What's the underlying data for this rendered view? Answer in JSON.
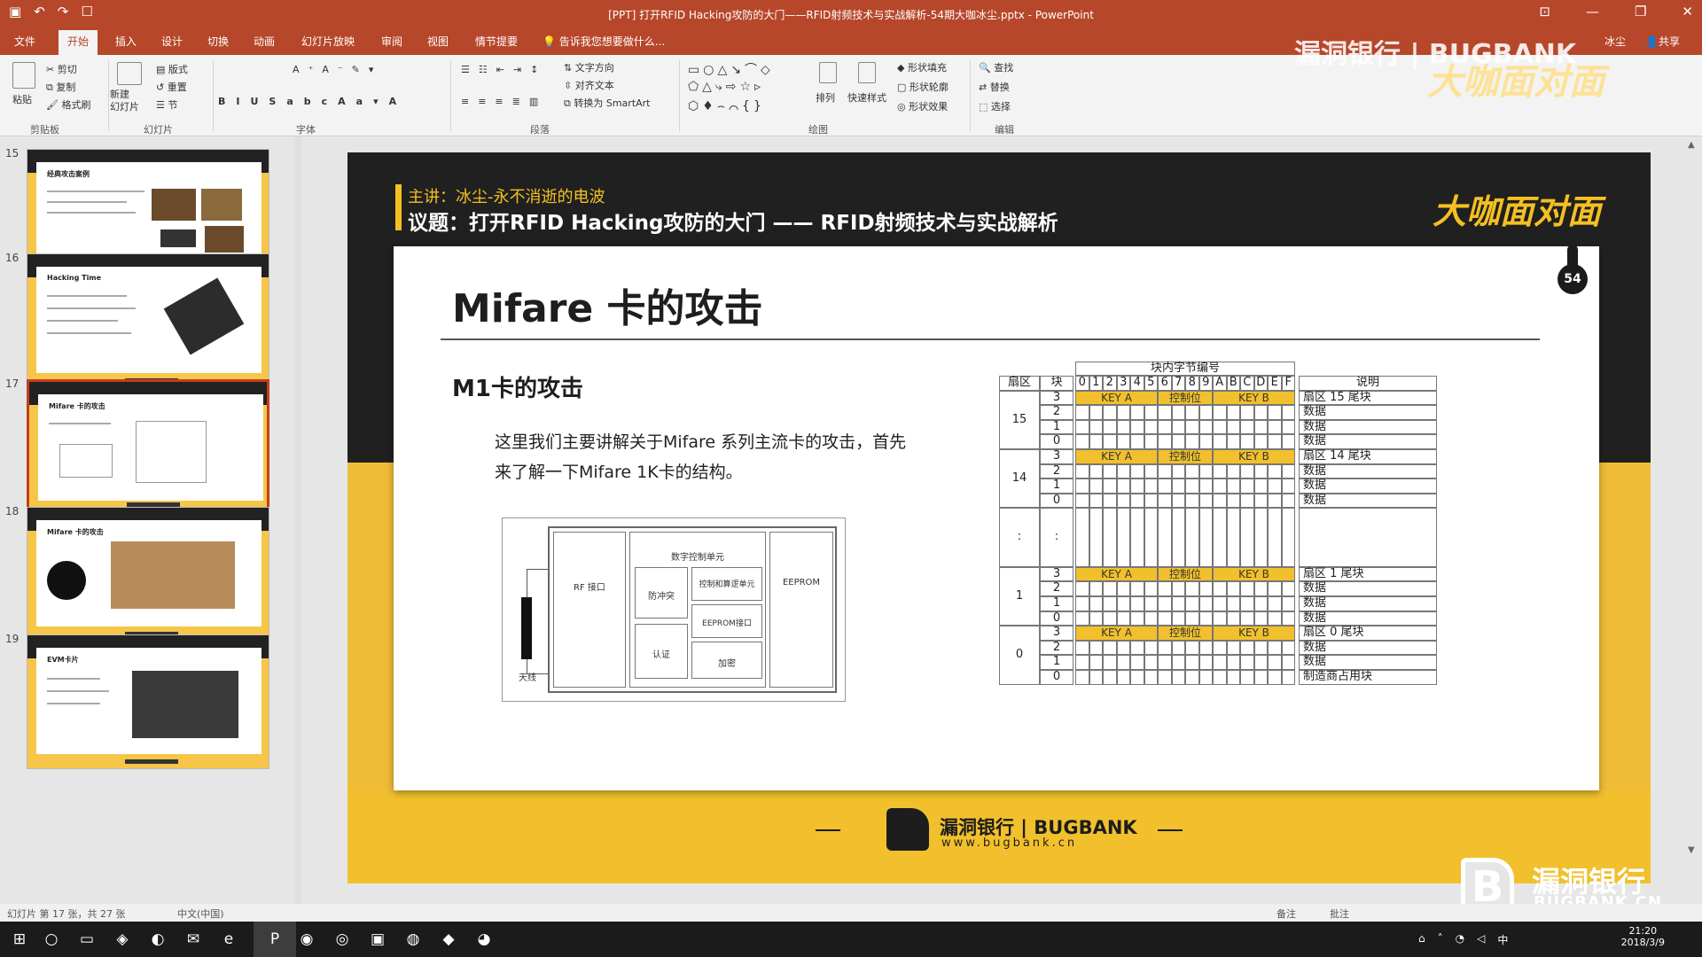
{
  "window": {
    "title": "[PPT] 打开RFID Hacking攻防的大门——RFID射频技术与实战解析-54期大咖冰尘.pptx - PowerPoint",
    "qat": [
      "▣",
      "↶",
      "↷",
      "☐"
    ]
  },
  "tabs": [
    "文件",
    "开始",
    "插入",
    "设计",
    "切换",
    "动画",
    "幻灯片放映",
    "审阅",
    "视图",
    "情节提要"
  ],
  "active_tab": "开始",
  "tell_me": "告诉我您想要做什么...",
  "account": {
    "user": "冰尘",
    "share": "共享"
  },
  "watermark_top": {
    "line1": "漏洞银行 | BUGBANK",
    "line2": "大咖面对面"
  },
  "ribbon": {
    "paste": "粘贴",
    "cut": "剪切",
    "copy": "复制",
    "format_painter": "格式刷",
    "new_slide": "新建\n幻灯片",
    "layout": "版式",
    "reset": "重置",
    "section": "节",
    "text_direction": "文字方向",
    "align_text": "对齐文本",
    "smartart": "转换为 SmartArt",
    "arrange": "排列",
    "quick_styles": "快速样式",
    "shape_fill": "形状填充",
    "shape_outline": "形状轮廓",
    "shape_effects": "形状效果",
    "find": "查找",
    "replace": "替换",
    "select": "选择",
    "groups": [
      "剪贴板",
      "幻灯片",
      "字体",
      "段落",
      "绘图",
      "编辑"
    ]
  },
  "thumbnails": [
    {
      "num": "15",
      "title": "经典攻击案例"
    },
    {
      "num": "16",
      "title": "Hacking Time"
    },
    {
      "num": "17",
      "title": "Mifare 卡的攻击"
    },
    {
      "num": "18",
      "title": "Mifare 卡的攻击"
    },
    {
      "num": "19",
      "title": "EVM卡片"
    }
  ],
  "slide": {
    "speaker": "主讲：冰尘-永不消逝的电波",
    "topic": "议题：打开RFID Hacking攻防的大门 —— RFID射频技术与实战解析",
    "brand": "大咖面对面",
    "page_num": "54",
    "title": "Mifare 卡的攻击",
    "subtitle": "M1卡的攻击",
    "para1": "这里我们主要讲解关于Mifare 系列主流卡的攻击，首先",
    "para2": "来了解一下Mifare 1K卡的结构。",
    "diagram": {
      "rf": "RF 接口",
      "digital": "数字控制单元",
      "anticoll": "防冲突",
      "control": "控制和算逻单元",
      "eeprom_if": "EEPROM接口",
      "auth": "认证",
      "crypto": "加密",
      "eeprom": "EEPROM",
      "antenna": "天线"
    },
    "table": {
      "header_bytes": "块内字节编号",
      "col_sector": "扇区",
      "col_block": "块",
      "col_desc": "说明",
      "byte_labels": [
        "0",
        "1",
        "2",
        "3",
        "4",
        "5",
        "6",
        "7",
        "8",
        "9",
        "A",
        "B",
        "C",
        "D",
        "E",
        "F"
      ],
      "key_a": "KEY A",
      "control_bits": "控制位",
      "key_b": "KEY B",
      "sectors": [
        {
          "sector": "15",
          "blocks": [
            "3",
            "2",
            "1",
            "0"
          ],
          "desc": [
            "扇区 15 尾块",
            "数据",
            "数据",
            "数据"
          ]
        },
        {
          "sector": "14",
          "blocks": [
            "3",
            "2",
            "1",
            "0"
          ],
          "desc": [
            "扇区 14 尾块",
            "数据",
            "数据",
            "数据"
          ]
        },
        {
          "sector": ":",
          "blocks": [
            ":"
          ],
          "desc": [
            ""
          ]
        },
        {
          "sector": "1",
          "blocks": [
            "3",
            "2",
            "1",
            "0"
          ],
          "desc": [
            "扇区 1 尾块",
            "数据",
            "数据",
            "数据"
          ]
        },
        {
          "sector": "0",
          "blocks": [
            "3",
            "2",
            "1",
            "0"
          ],
          "desc": [
            "扇区 0 尾块",
            "数据",
            "数据",
            "制造商占用块"
          ]
        }
      ]
    },
    "footer_logo": "漏洞银行 | BUGBANK",
    "footer_url": "www.bugbank.cn"
  },
  "watermark_bottom": {
    "line1": "漏洞银行",
    "line2": "BUGBANK.CN"
  },
  "statusbar": {
    "slide_info": "幻灯片 第 17 张，共 27 张",
    "lang": "中文(中国)",
    "notes": "备注",
    "comments": "批注"
  },
  "taskbar": {
    "time": "21:20",
    "date": "2018/3/9",
    "ime": "中"
  }
}
